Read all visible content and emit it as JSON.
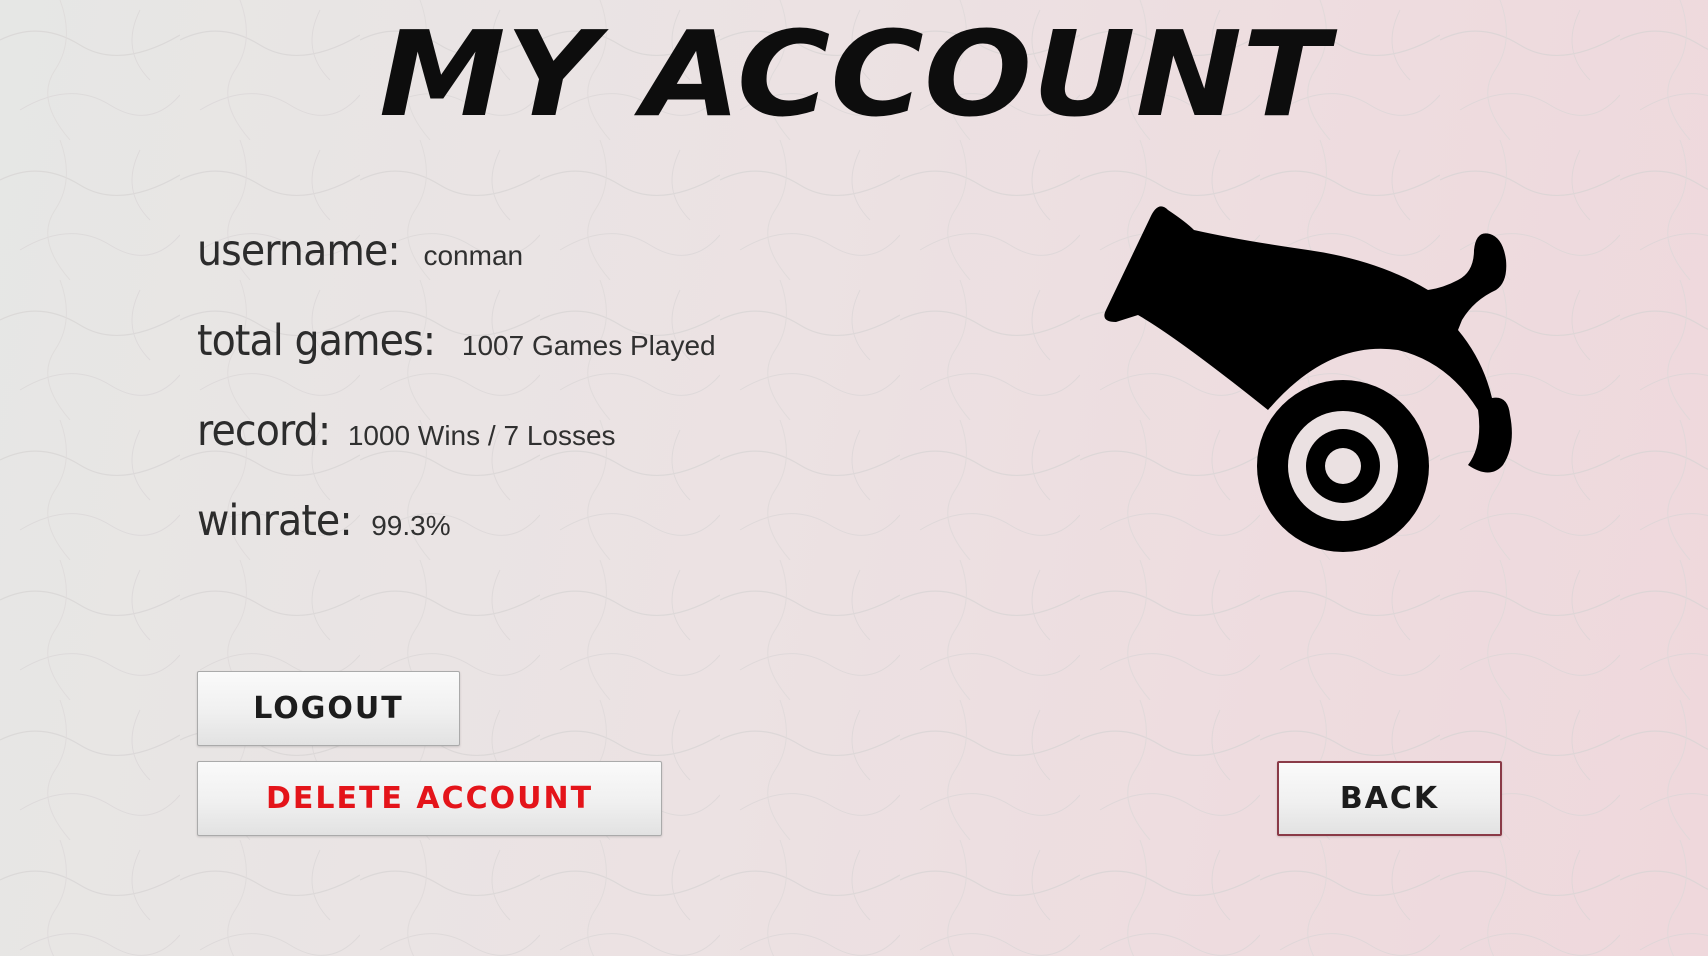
{
  "header": {
    "title": "MY ACCOUNT"
  },
  "account": {
    "username_label": "username:",
    "username_value": "conman",
    "games_label": "total games:",
    "games_value": "1007 Games Played",
    "record_label": "record:",
    "record_value": "1000 Wins / 7 Losses",
    "winrate_label": "winrate:",
    "winrate_value": "99.3%"
  },
  "actions": {
    "logout_label": "LOGOUT",
    "delete_label": "DELETE ACCOUNT",
    "back_label": "BACK"
  },
  "icons": {
    "avatar": "cannon-icon"
  },
  "colors": {
    "title": "#0d0d0d",
    "delete_text": "#e4141a",
    "back_border": "#8a3a47",
    "cannon": "#000000"
  }
}
